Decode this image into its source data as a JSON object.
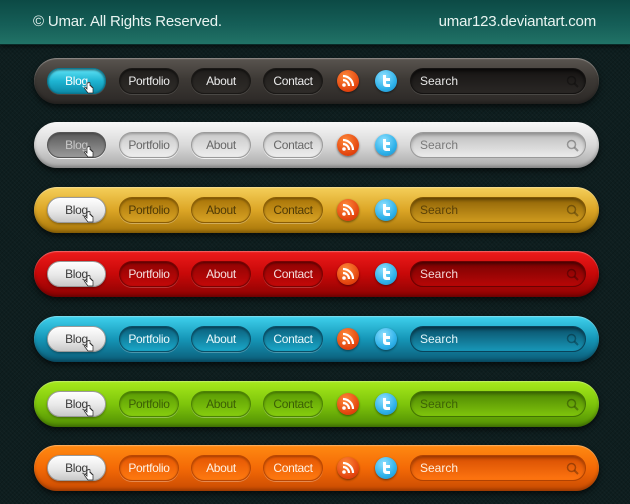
{
  "header": {
    "copyright": "© Umar. All Rights Reserved.",
    "site": "umar123.deviantart.com"
  },
  "nav_labels": [
    "Blog",
    "Portfolio",
    "About",
    "Contact"
  ],
  "search_placeholder": "Search",
  "icons": {
    "rss": "rss-feed-icon",
    "twitter": "twitter-icon",
    "search": "magnifier-icon",
    "cursor": "hand-pointer-cursor-icon"
  },
  "bars": [
    {
      "theme": "dark",
      "active": "Blog",
      "accent": "#1eb4d2"
    },
    {
      "theme": "silver",
      "active": "Blog",
      "accent": "#8a8a8a"
    },
    {
      "theme": "gold",
      "active": "Blog",
      "accent": "#dca626"
    },
    {
      "theme": "red",
      "active": "Blog",
      "accent": "#c70808"
    },
    {
      "theme": "cyan",
      "active": "Blog",
      "accent": "#1596b7"
    },
    {
      "theme": "green",
      "active": "Blog",
      "accent": "#7ec50b"
    },
    {
      "theme": "orange",
      "active": "Blog",
      "accent": "#f46a06"
    }
  ]
}
